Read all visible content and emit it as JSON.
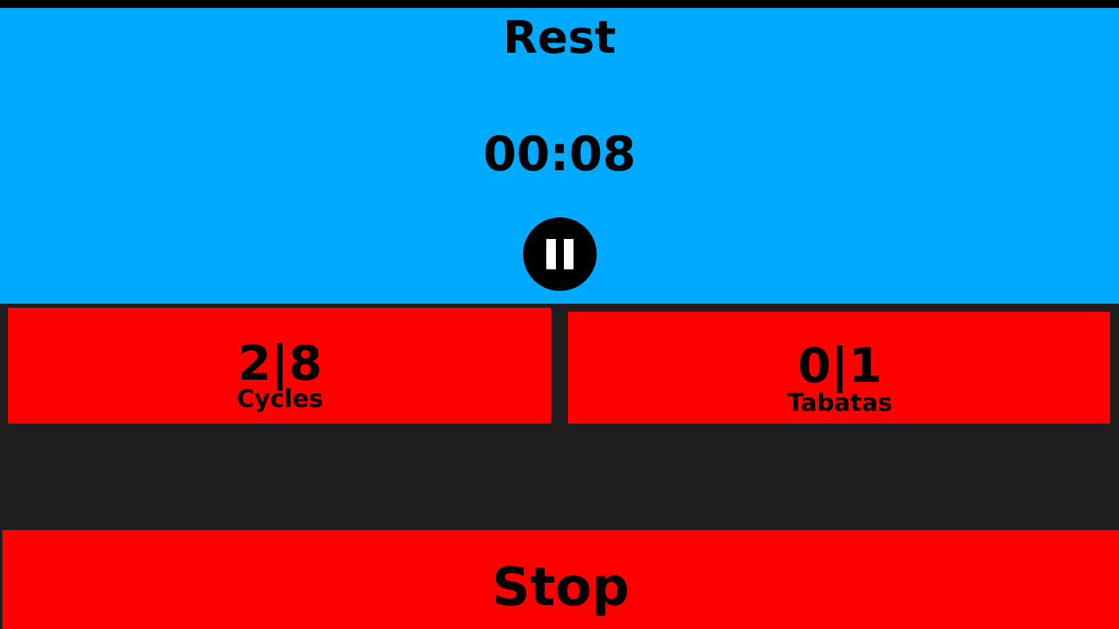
{
  "timer": {
    "phase": "Rest",
    "time_remaining": "00:08",
    "background_color": "#00aaff"
  },
  "controls": {
    "pause_icon": "pause-icon",
    "stop_label": "Stop"
  },
  "counters": {
    "cycles": {
      "value": "2|8",
      "label": "Cycles"
    },
    "tabatas": {
      "value": "0|1",
      "label": "Tabatas"
    }
  },
  "colors": {
    "accent_red": "#ff0000",
    "background_dark": "#1e1e1e",
    "text": "#000000"
  }
}
